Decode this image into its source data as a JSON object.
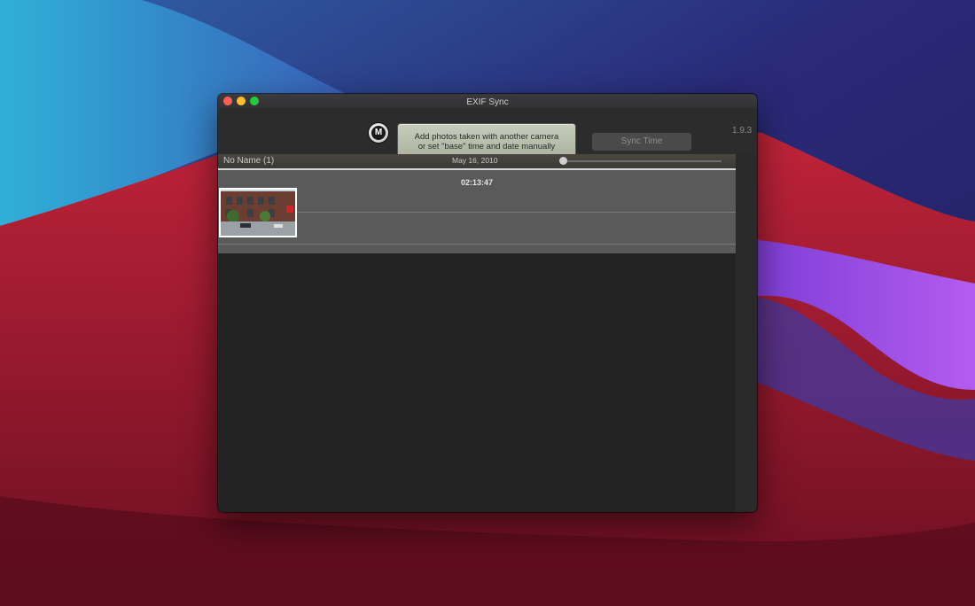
{
  "window": {
    "title": "EXIF Sync",
    "version": "1.9.3"
  },
  "toolbar": {
    "manual_button_label": "M",
    "add_photos_line1": "Add photos taken with another camera",
    "add_photos_line2": "or set \"base\" time and date manually",
    "sync_time_label": "Sync Time"
  },
  "track": {
    "source_name": "No Name (1)",
    "date": "May 16, 2010",
    "time": "02:13:47",
    "photo_count": 1
  },
  "colors": {
    "close": "#fe5f57",
    "minimize": "#febc2e",
    "zoom": "#28c840",
    "button_accent": "#b7bfaa"
  }
}
